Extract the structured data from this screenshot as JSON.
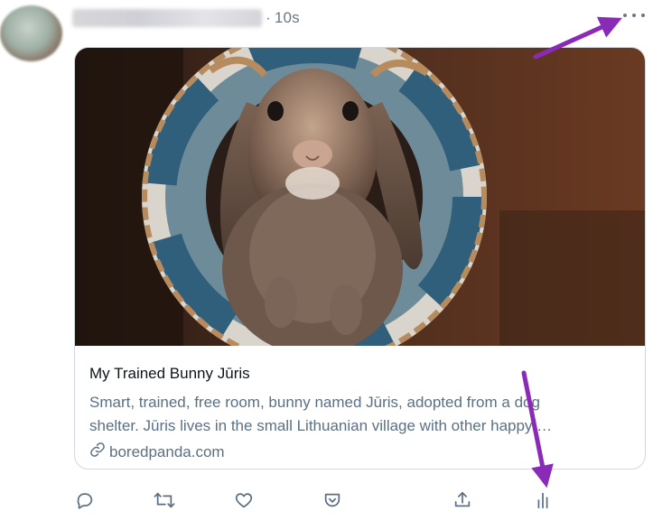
{
  "tweet": {
    "time_sep": "·",
    "time": "10s"
  },
  "card": {
    "title": "My Trained Bunny Jūris",
    "description_line1": "Smart, trained, free room, bunny named Jūris, adopted from a dog",
    "description_line2": "shelter. Jūris lives in the small Lithuanian village with other happy …",
    "domain": "boredpanda.com"
  },
  "icons": {
    "more": "more-horizontal-icon",
    "link": "link-icon",
    "reply": "reply-icon",
    "retweet": "retweet-icon",
    "like": "heart-icon",
    "save": "pocket-save-icon",
    "share": "share-icon",
    "analytics": "analytics-icon"
  },
  "colors": {
    "annotation_arrow": "#8a2bb8",
    "muted_text": "#5b7083",
    "icon_gray": "#5b7083",
    "card_border": "#cfd9de"
  }
}
